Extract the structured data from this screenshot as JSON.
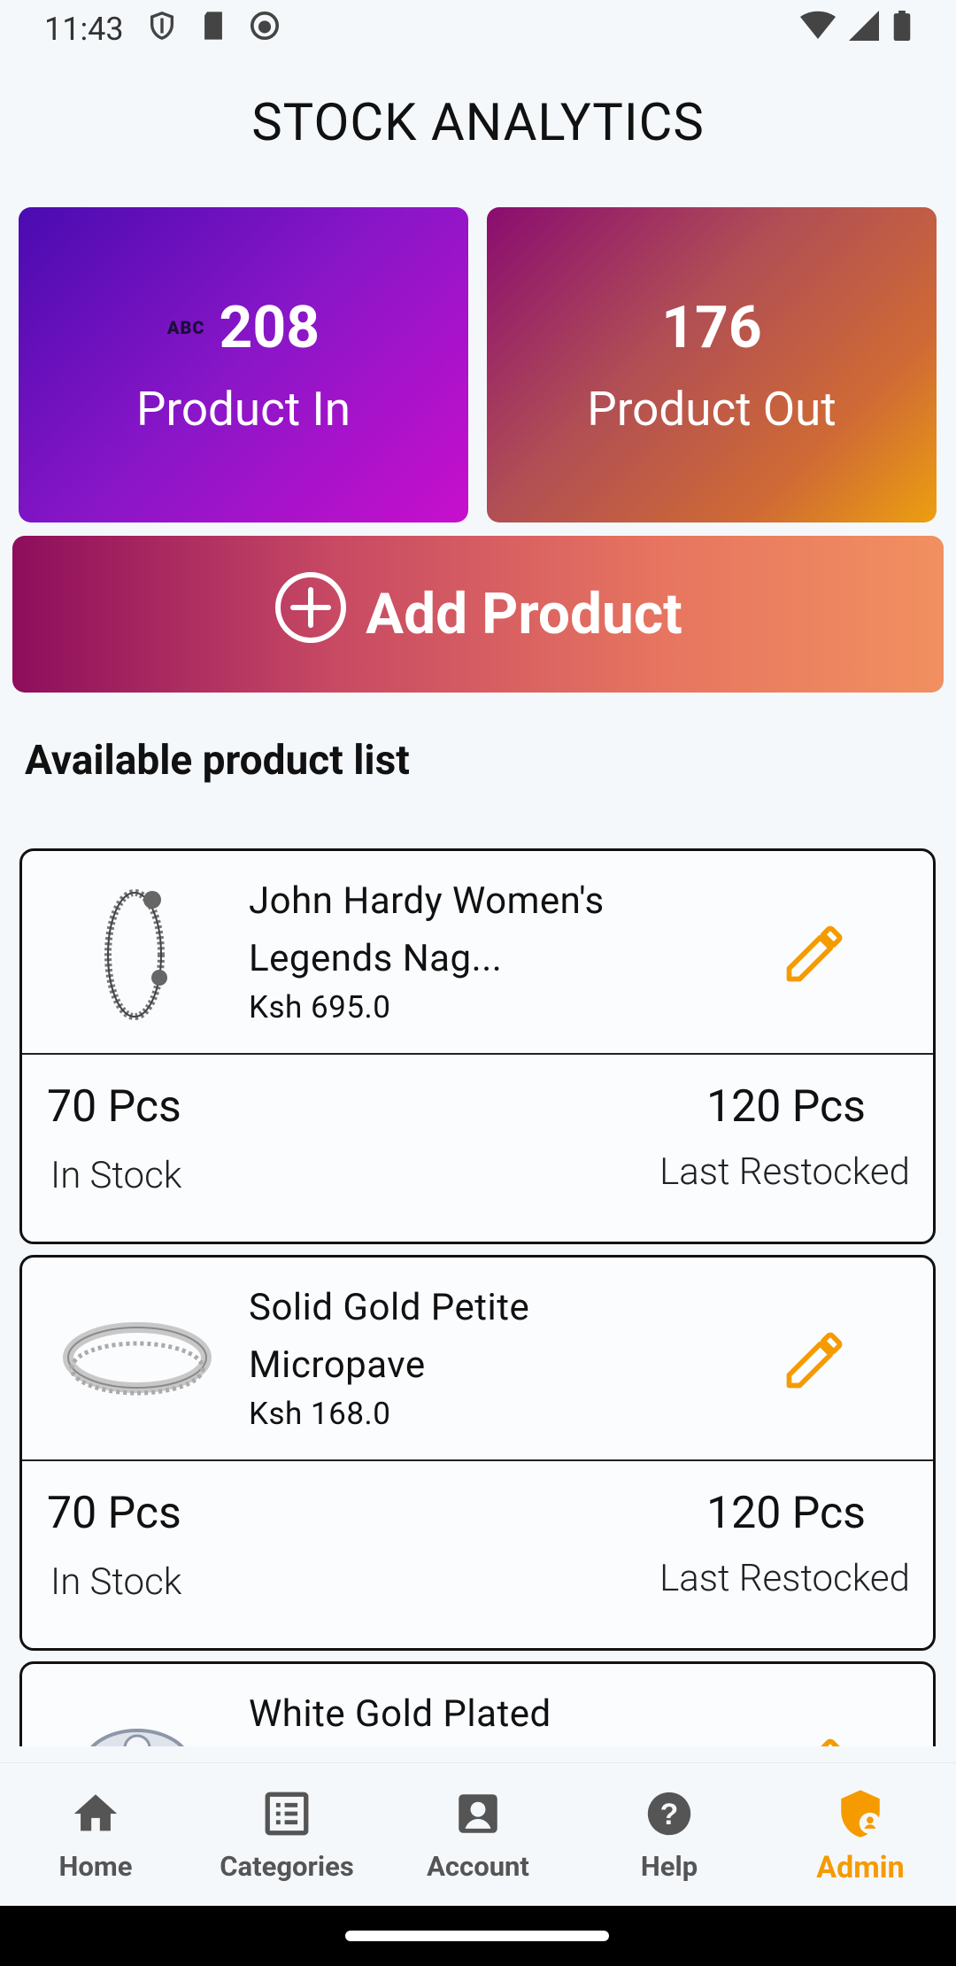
{
  "status_bar": {
    "time": "11:43"
  },
  "header": {
    "title": "STOCK ANALYTICS"
  },
  "stats": {
    "in": {
      "badge": "ABC",
      "value": "208",
      "label": "Product In"
    },
    "out": {
      "value": "176",
      "label": "Product Out"
    }
  },
  "add_button": {
    "label": "Add Product"
  },
  "section": {
    "title": "Available product list"
  },
  "products": [
    {
      "name": "John Hardy Women's Legends Nag...",
      "price": "Ksh 695.0",
      "stock_value": "70 Pcs",
      "stock_label": "In Stock",
      "restock_value": "120 Pcs",
      "restock_label": "Last Restocked"
    },
    {
      "name": "Solid Gold Petite Micropave",
      "price": "Ksh 168.0",
      "stock_value": "70 Pcs",
      "stock_label": "In Stock",
      "restock_value": "120 Pcs",
      "restock_label": "Last Restocked"
    },
    {
      "name": "White Gold Plated",
      "price": "",
      "stock_value": "",
      "stock_label": "",
      "restock_value": "",
      "restock_label": ""
    }
  ],
  "nav": {
    "home": "Home",
    "categories": "Categories",
    "account": "Account",
    "help": "Help",
    "admin": "Admin"
  },
  "colors": {
    "accent": "#f59b00"
  }
}
